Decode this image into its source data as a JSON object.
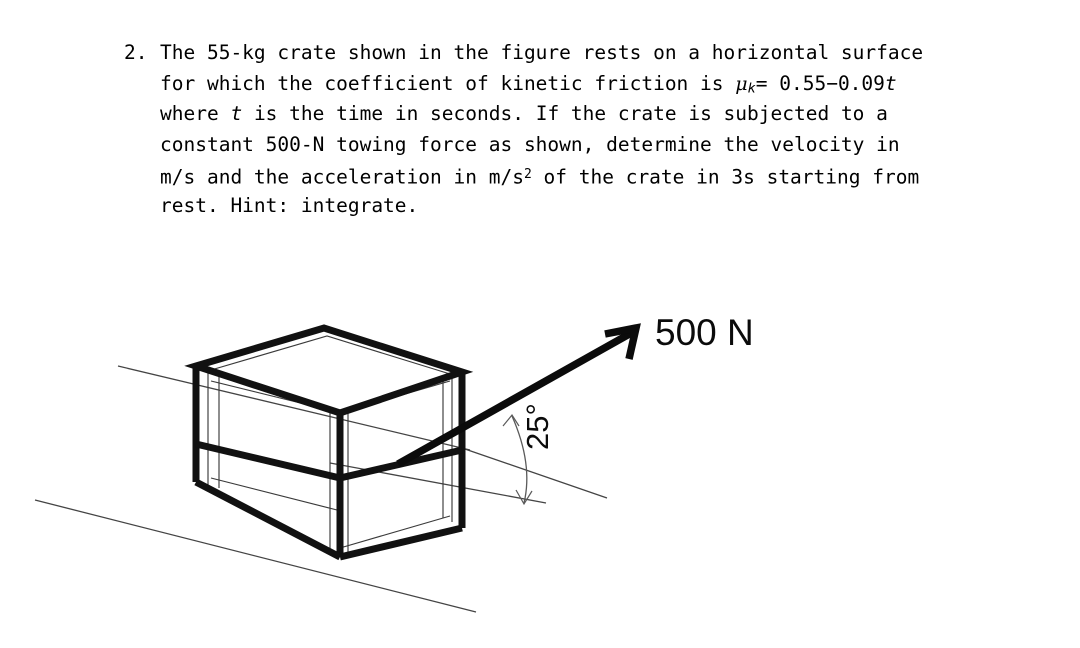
{
  "problem": {
    "number": "2.",
    "lines": [
      "The 55-kg crate shown in the figure rests on a horizontal surface",
      "for which the coefficient of kinetic friction is ",
      "where ",
      "constant 500-N towing force as shown, determine the velocity in",
      "m/s and the acceleration in m/s",
      "rest. Hint: integrate."
    ],
    "line2_prefix": "for which the coefficient of kinetic friction is ",
    "mu_symbol": "μ",
    "mu_subscript": "k",
    "mu_equals": "= 0.55−0.09",
    "mu_trailing_var": "t",
    "line3_prefix": "where ",
    "line3_var": "t",
    "line3_rest": " is the time in seconds. If the crate is subjected to a",
    "line5_prefix": "m/s and the acceleration in m/s",
    "line5_exponent": "2",
    "line5_rest": " of the crate in 3s starting from",
    "mass": "55-kg",
    "force_value": "500-N",
    "mu_expression": "0.55−0.09t",
    "time_value": "3s",
    "hint": "Hint: integrate."
  },
  "figure": {
    "force_label": "500 N",
    "angle_label": "25°",
    "angle_degrees": 25,
    "force_magnitude": 500,
    "force_unit": "N",
    "crate_description": "isometric-crate",
    "surface_description": "horizontal-ground-line"
  },
  "colors": {
    "ink": "#111111",
    "thin_ink": "#3a3a3a",
    "background": "#ffffff",
    "arc": "#5a5a5a"
  }
}
